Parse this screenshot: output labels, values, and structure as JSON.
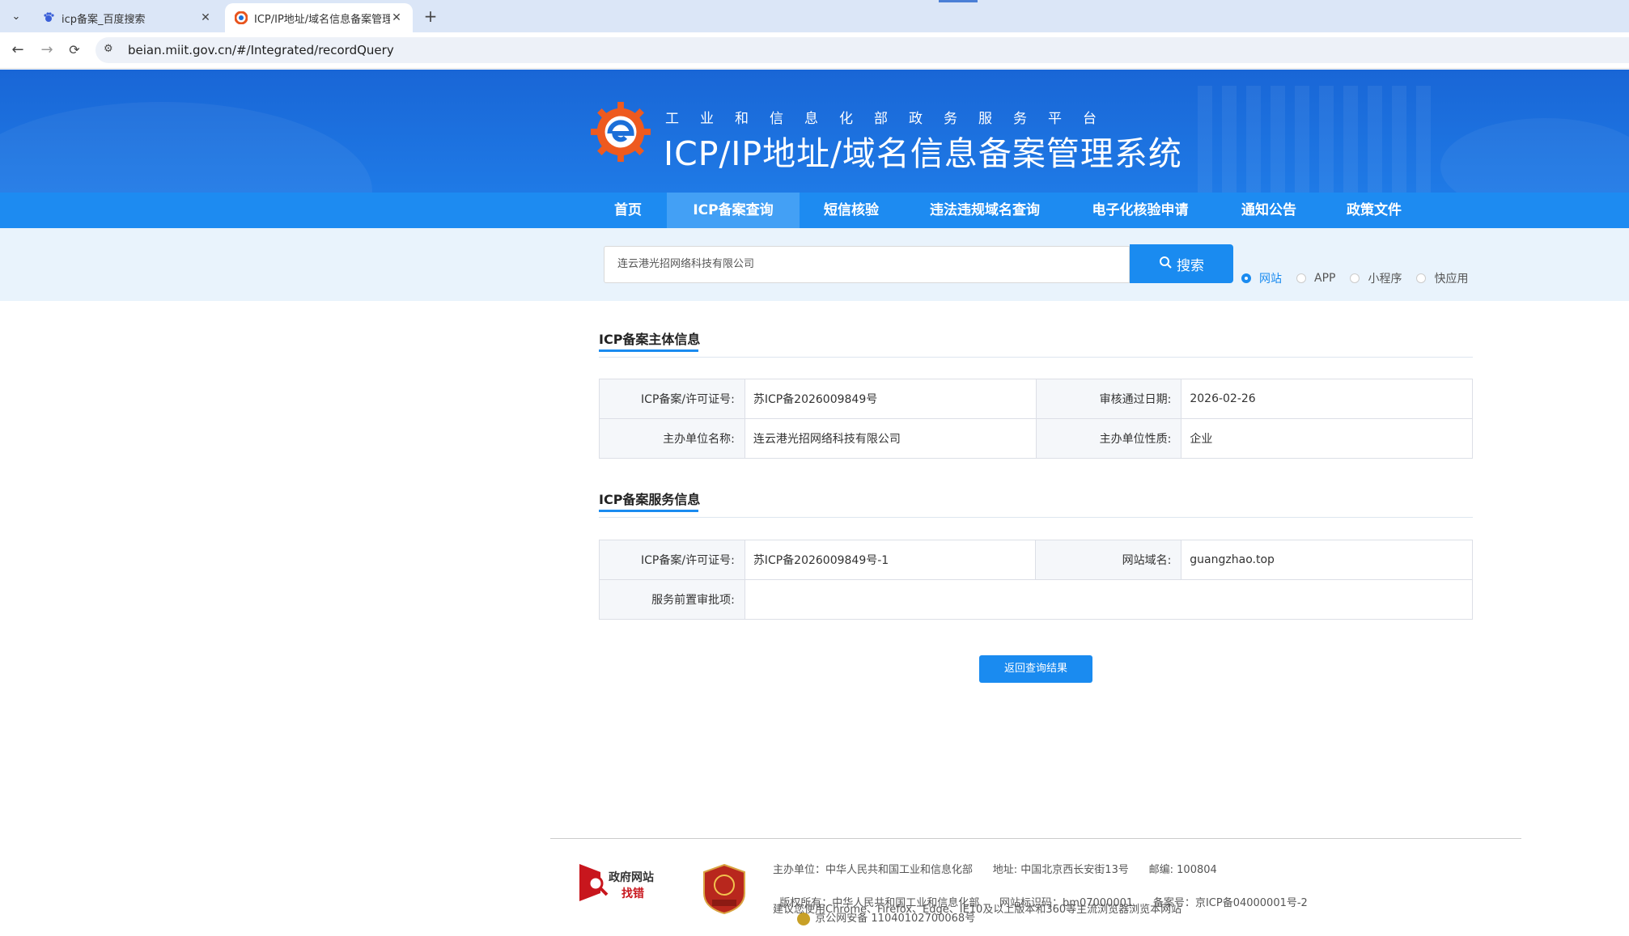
{
  "browser": {
    "tabs": [
      {
        "title": "icp备案_百度搜索",
        "active": false
      },
      {
        "title": "ICP/IP地址/域名信息备案管理系",
        "active": true
      }
    ],
    "url": "beian.miit.gov.cn/#/Integrated/recordQuery"
  },
  "header": {
    "subtitle": "工业和信息化部政务服务平台",
    "title": "ICP/IP地址/域名信息备案管理系统"
  },
  "nav": {
    "items": [
      {
        "label": "首页",
        "active": false
      },
      {
        "label": "ICP备案查询",
        "active": true
      },
      {
        "label": "短信核验",
        "active": false
      },
      {
        "label": "违法违规域名查询",
        "active": false
      },
      {
        "label": "电子化核验申请",
        "active": false
      },
      {
        "label": "通知公告",
        "active": false
      },
      {
        "label": "政策文件",
        "active": false
      }
    ]
  },
  "search": {
    "value": "连云港光招网络科技有限公司",
    "button": "搜索",
    "types": [
      {
        "label": "网站",
        "selected": true
      },
      {
        "label": "APP",
        "selected": false
      },
      {
        "label": "小程序",
        "selected": false
      },
      {
        "label": "快应用",
        "selected": false
      }
    ]
  },
  "subject": {
    "title": "ICP备案主体信息",
    "license_label": "ICP备案/许可证号:",
    "license": "苏ICP备2026009849号",
    "date_label": "审核通过日期:",
    "date": "2026-02-26",
    "org_label": "主办单位名称:",
    "org": "连云港光招网络科技有限公司",
    "nature_label": "主办单位性质:",
    "nature": "企业"
  },
  "service": {
    "title": "ICP备案服务信息",
    "license_label": "ICP备案/许可证号:",
    "license": "苏ICP备2026009849号-1",
    "domain_label": "网站域名:",
    "domain": "guangzhao.top",
    "approval_label": "服务前置审批项:",
    "approval": ""
  },
  "back_button": "返回查询结果",
  "footer": {
    "find_error_1": "政府网站",
    "find_error_2": "找错",
    "line1": "主办单位：中华人民共和国工业和信息化部      地址: 中国北京西长安街13号      邮编: 100804",
    "line2a": "版权所有：中华人民共和国工业和信息化部      网站标识码：bm07000001      备案号：京ICP备04000001号-2",
    "line2b": "京公网安备 11040102700068号",
    "line3": "建议您使用Chrome、Firefox、Edge、IE10及以上版本和360等主流浏览器浏览本网站"
  }
}
